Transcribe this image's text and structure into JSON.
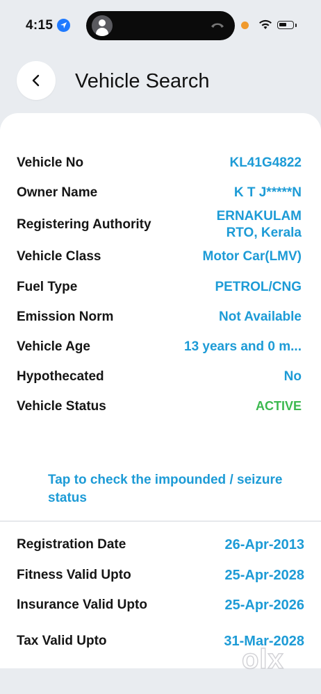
{
  "status_bar": {
    "time": "4:15",
    "icons": [
      "location-arrow-icon",
      "avatar-icon",
      "phone-hangup-icon",
      "recording-dot-icon",
      "wifi-icon",
      "battery-icon"
    ],
    "accent_colors": {
      "location": "#1f7aff",
      "recording": "#f09a2e"
    }
  },
  "header": {
    "title": "Vehicle Search",
    "back_icon": "chevron-left-icon"
  },
  "details": {
    "vehicle_no": {
      "label": "Vehicle No",
      "value": "KL41G4822"
    },
    "owner_name": {
      "label": "Owner Name",
      "value": "K T J*****N"
    },
    "registering_authority": {
      "label": "Registering Authority",
      "value": "ERNAKULAM RTO, Kerala"
    },
    "vehicle_class": {
      "label": "Vehicle Class",
      "value": "Motor Car(LMV)"
    },
    "fuel_type": {
      "label": "Fuel Type",
      "value": "PETROL/CNG"
    },
    "emission_norm": {
      "label": "Emission Norm",
      "value": "Not Available"
    },
    "vehicle_age": {
      "label": "Vehicle Age",
      "value": "13 years and 0 m..."
    },
    "hypothecated": {
      "label": "Hypothecated",
      "value": "No"
    },
    "vehicle_status": {
      "label": "Vehicle Status",
      "value": "ACTIVE"
    }
  },
  "impound_link": "Tap to check the impounded / seizure status",
  "validity": {
    "registration_date": {
      "label": "Registration Date",
      "value": "26-Apr-2013"
    },
    "fitness_valid_upto": {
      "label": "Fitness Valid Upto",
      "value": "25-Apr-2028"
    },
    "insurance_valid_upto": {
      "label": "Insurance Valid Upto",
      "value": "25-Apr-2026"
    },
    "tax_valid_upto": {
      "label": "Tax Valid Upto",
      "value": "31-Mar-2028"
    }
  },
  "watermark": "olx",
  "colors": {
    "value_blue": "#1d9bd6",
    "active_green": "#3cb94f",
    "background": "#e9ecf0"
  }
}
